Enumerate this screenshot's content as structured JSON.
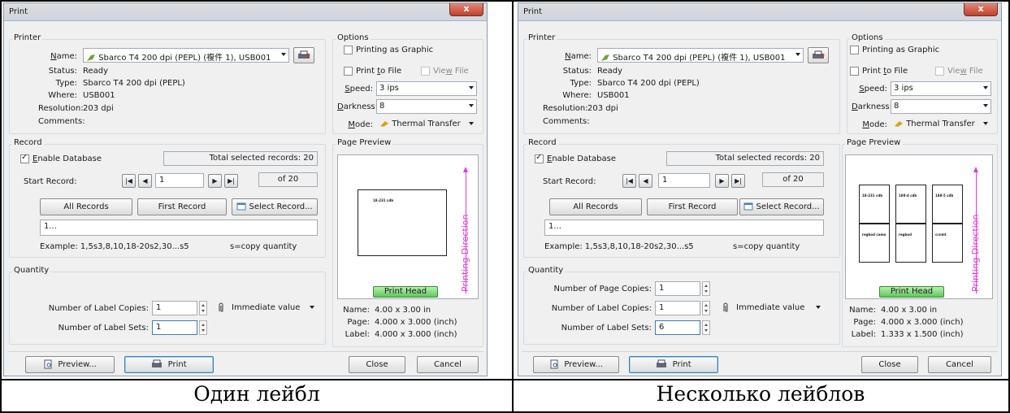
{
  "dialog": {
    "title": "Print",
    "close_glyph": "x",
    "printer": {
      "group_label": "Printer",
      "name_label": "Name:",
      "name_value": "Sbarco T4 200 dpi (PEPL) (複件 1), USB001",
      "status_label": "Status:",
      "status_value": "Ready",
      "type_label": "Type:",
      "type_value": "Sbarco T4 200 dpi (PEPL)",
      "where_label": "Where:",
      "where_value": "USB001",
      "resolution_label": "Resolution:",
      "resolution_value": "203 dpi",
      "comments_label": "Comments:"
    },
    "options": {
      "group_label": "Options",
      "printing_as_graphic": "Printing as Graphic",
      "print_to_file": "Print to File",
      "view_file": "View File",
      "speed_label": "Speed:",
      "speed_value": "3 ips",
      "darkness_label": "Darkness:",
      "darkness_value": "8",
      "mode_label": "Mode:",
      "mode_value": "Thermal Transfer"
    },
    "record": {
      "group_label": "Record",
      "enable_database": "Enable Database",
      "total_selected": "Total selected records: 20",
      "start_record_label": "Start Record:",
      "start_record_value": "1",
      "of_total": "of 20",
      "all_records": "All Records",
      "first_record": "First Record",
      "select_record": "Select Record...",
      "range_value": "1...",
      "example": "Example: 1,5s3,8,10,18-20s2,30...s5",
      "copy_hint": "s=copy quantity"
    },
    "quantity": {
      "group_label": "Quantity",
      "page_copies_label": "Number of Page Copies:",
      "label_copies_label": "Number of Label Copies:",
      "label_sets_label": "Number of Label Sets:",
      "immediate_value": "Immediate value"
    },
    "preview": {
      "group_label": "Page Preview",
      "printing_direction": "Printing Direction",
      "print_head": "Print Head",
      "name_label": "Name:",
      "name_value": "4.00 x 3.00 in",
      "page_label": "Page:",
      "page_value": "4.000 x 3.000 (inch)",
      "label_label": "Label:"
    },
    "buttons": {
      "preview": "Preview...",
      "print": "Print",
      "close": "Close",
      "cancel": "Cancel"
    }
  },
  "left": {
    "caption": "Один лейбл",
    "label_copies": "1",
    "label_sets": "1",
    "label_size": "4.000 x 3.000 (inch)",
    "preview_text": "18-231 cdb"
  },
  "right": {
    "caption": "Несколько лейблов",
    "page_copies": "1",
    "label_copies": "1",
    "label_sets": "6",
    "label_size": "1.333 x 1.500 (inch)",
    "preview_cells": [
      "18-231 cdb",
      "188-4 cdb",
      "188-5 cdb",
      "regbod camo",
      "regbod",
      "ccnmt"
    ]
  },
  "colors": {
    "print_direction": "#e03bd8",
    "print_head": "#5fc85a",
    "close_button": "#c2402a"
  }
}
